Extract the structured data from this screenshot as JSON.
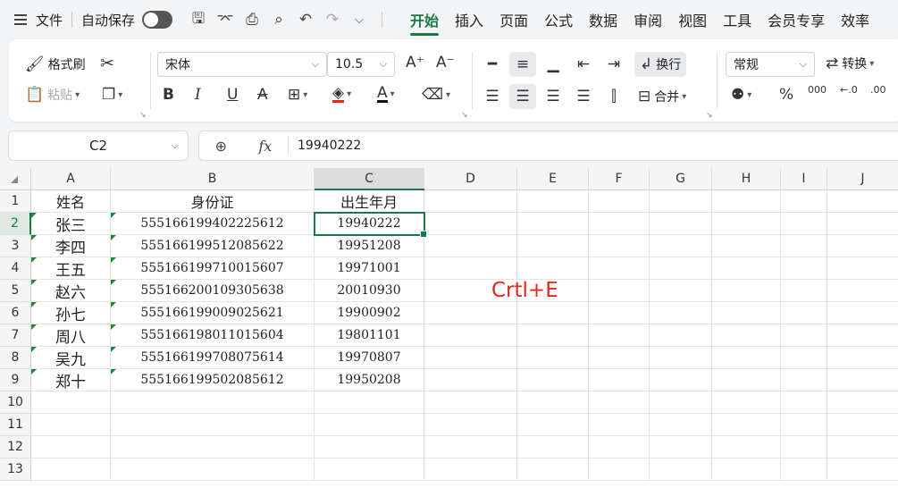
{
  "menu": {
    "file_label": "文件",
    "autosave_label": "自动保存",
    "tabs": [
      "开始",
      "插入",
      "页面",
      "公式",
      "数据",
      "审阅",
      "视图",
      "工具",
      "会员专享",
      "效率"
    ]
  },
  "ribbon": {
    "format_painter": "格式刷",
    "paste": "粘贴",
    "font_name": "宋体",
    "font_size": "10.5",
    "wrap_text": "换行",
    "merge": "合并",
    "number_format": "常规",
    "convert": "转换"
  },
  "formula_bar": {
    "cell_ref": "C2",
    "fx": "fx",
    "value": "19940222"
  },
  "sheet": {
    "columns": [
      "A",
      "B",
      "C",
      "D",
      "E",
      "F",
      "G",
      "H",
      "I",
      "J"
    ],
    "rows": [
      "1",
      "2",
      "3",
      "4",
      "5",
      "6",
      "7",
      "8",
      "9",
      "10",
      "11",
      "12",
      "13"
    ],
    "headers": [
      "姓名",
      "身份证",
      "出生年月"
    ],
    "data": [
      [
        "张三",
        "555166199402225612",
        "19940222"
      ],
      [
        "李四",
        "555166199512085622",
        "19951208"
      ],
      [
        "王五",
        "555166199710015607",
        "19971001"
      ],
      [
        "赵六",
        "555166200109305638",
        "20010930"
      ],
      [
        "孙七",
        "555166199009025621",
        "19900902"
      ],
      [
        "周八",
        "555166198011015604",
        "19801101"
      ],
      [
        "吴九",
        "555166199708075614",
        "19970807"
      ],
      [
        "郑十",
        "555166199502085612",
        "19950208"
      ]
    ],
    "annotation": "Crtl+E"
  },
  "colors": {
    "accent": "#1a7a45",
    "annotation": "#e8261c"
  }
}
